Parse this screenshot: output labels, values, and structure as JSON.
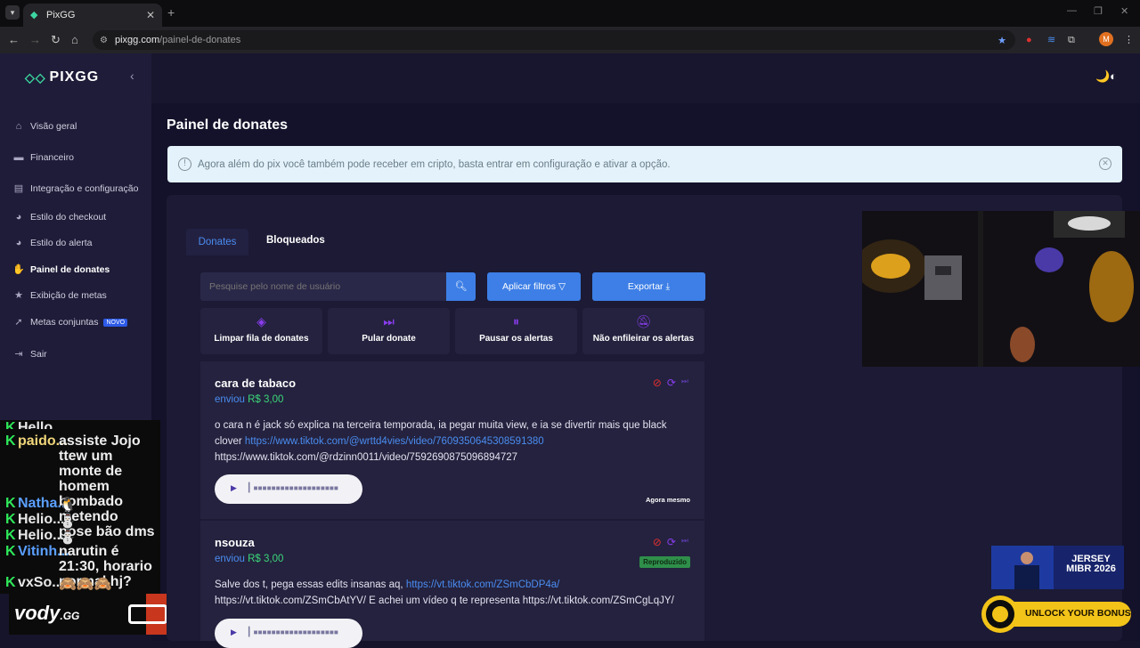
{
  "browser": {
    "tab_title": "PixGG",
    "url_host": "pixgg.com",
    "url_path": "/painel-de-donates",
    "profile_initial": "M"
  },
  "sidebar": {
    "brand": "PIXGG",
    "items": [
      {
        "label": "Visão geral",
        "icon": "home-icon"
      },
      {
        "label": "Financeiro",
        "icon": "wallet-icon"
      },
      {
        "label": "Integração e configuração",
        "icon": "settings-icon"
      },
      {
        "label": "Estilo do checkout",
        "icon": "palette-icon"
      },
      {
        "label": "Estilo do alerta",
        "icon": "palette-icon"
      },
      {
        "label": "Painel de donates",
        "icon": "donate-icon",
        "active": true
      },
      {
        "label": "Exibição de metas",
        "icon": "star-icon"
      },
      {
        "label": "Metas conjuntas",
        "icon": "rocket-icon",
        "badge": "NOVO"
      },
      {
        "label": "Sair",
        "icon": "logout-icon"
      }
    ]
  },
  "chat": {
    "lines": [
      {
        "user": "Hello...",
        "user_color": "#e8e8e8",
        "message": ""
      },
      {
        "user": "paido...",
        "user_color": "#f0d67a",
        "message": "assiste Jojo ttew um monte de homem bombado metendo pose bão dms"
      },
      {
        "user": "Natha...",
        "user_color": "#5aa0ff",
        "message": ""
      },
      {
        "user": "Helio...",
        "user_color": "#e8e8e8",
        "message": ""
      },
      {
        "user": "Helio...",
        "user_color": "#e8e8e8",
        "message": ""
      },
      {
        "user": "Vitinh...",
        "user_color": "#5aa0ff",
        "message": "narutin é 21:30, horario normal hj?"
      },
      {
        "user": "vxSo...",
        "user_color": "#e8e8e8",
        "message": ""
      }
    ]
  },
  "page": {
    "title": "Painel de donates",
    "notice": "Agora além do pix você também pode receber em cripto, basta entrar em configuração e ativar a opção.",
    "tabs": [
      "Donates",
      "Bloqueados"
    ],
    "search_placeholder": "Pesquise pelo nome de usuário",
    "filter_label": "Aplicar filtros",
    "export_label": "Exportar",
    "actions": [
      {
        "label": "Limpar fila de donates",
        "icon": "eraser-icon"
      },
      {
        "label": "Pular donate",
        "icon": "skip-icon"
      },
      {
        "label": "Pausar os alertas",
        "icon": "pause-icon"
      },
      {
        "label": "Não enfileirar os alertas",
        "icon": "bell-off-icon"
      }
    ],
    "donations": [
      {
        "name": "cara de tabaco",
        "sent_label": "enviou",
        "amount": "R$ 3,00",
        "message_text": "o cara n é jack só explica na terceira temporada, ia pegar muita view, e ia se divertir mais que black clover ",
        "message_link": "https://www.tiktok.com/@wrttd4vies/video/7609350645308591380",
        "message_tail": "https://www.tiktok.com/@rdzinn0011/video/7592690875096894727",
        "time": "Agora mesmo"
      },
      {
        "name": "nsouza",
        "sent_label": "enviou",
        "amount": "R$ 3,00",
        "status": "Reproduzido",
        "message_text": "Salve dos t, pega essas edits insanas aq, ",
        "message_link": "https://vt.tiktok.com/ZSmCbDP4a/",
        "message_tail": "https://vt.tiktok.com/ZSmCbAtYV/ E achei um vídeo q te representa https://vt.tiktok.com/ZSmCgLqJY/"
      }
    ]
  },
  "overlays": {
    "vody_brand": "vody",
    "vody_suffix": ".GG",
    "jersey_promo": [
      "JERSEY",
      "MIBR 2026"
    ],
    "bonus_promo": "UNLOCK YOUR BONUS"
  }
}
